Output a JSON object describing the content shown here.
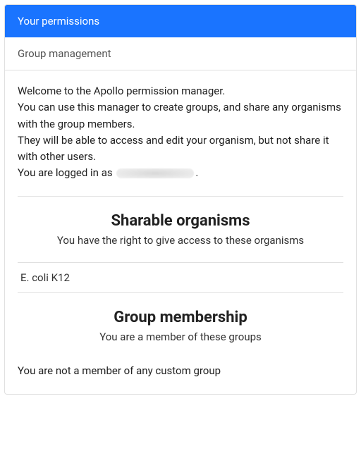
{
  "header": {
    "title": "Your permissions",
    "subtitle": "Group management"
  },
  "intro": {
    "line1": "Welcome to the Apollo permission manager.",
    "line2": "You can use this manager to create groups, and share any organisms with the group members.",
    "line3": "They will be able to access and edit your organism, but not share it with other users.",
    "login_prefix": "You are logged in as ",
    "login_suffix": "."
  },
  "sections": {
    "sharable": {
      "title": "Sharable organisms",
      "subtitle": "You have the right to give access to these organisms",
      "items": [
        "E. coli K12"
      ]
    },
    "membership": {
      "title": "Group membership",
      "subtitle": "You are a member of these groups",
      "empty_message": "You are not a member of any custom group"
    }
  }
}
